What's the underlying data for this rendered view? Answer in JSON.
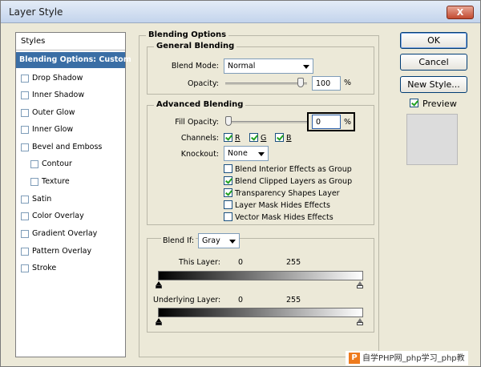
{
  "window": {
    "title": "Layer Style",
    "close_label": "X"
  },
  "styles": {
    "header": "Styles",
    "items": [
      {
        "label": "Blending Options: Custom",
        "active": true,
        "checkbox": false,
        "sub": false
      },
      {
        "label": "Drop Shadow",
        "active": false,
        "checkbox": true,
        "sub": false
      },
      {
        "label": "Inner Shadow",
        "active": false,
        "checkbox": true,
        "sub": false
      },
      {
        "label": "Outer Glow",
        "active": false,
        "checkbox": true,
        "sub": false
      },
      {
        "label": "Inner Glow",
        "active": false,
        "checkbox": true,
        "sub": false
      },
      {
        "label": "Bevel and Emboss",
        "active": false,
        "checkbox": true,
        "sub": false
      },
      {
        "label": "Contour",
        "active": false,
        "checkbox": true,
        "sub": true
      },
      {
        "label": "Texture",
        "active": false,
        "checkbox": true,
        "sub": true
      },
      {
        "label": "Satin",
        "active": false,
        "checkbox": true,
        "sub": false
      },
      {
        "label": "Color Overlay",
        "active": false,
        "checkbox": true,
        "sub": false
      },
      {
        "label": "Gradient Overlay",
        "active": false,
        "checkbox": true,
        "sub": false
      },
      {
        "label": "Pattern Overlay",
        "active": false,
        "checkbox": true,
        "sub": false
      },
      {
        "label": "Stroke",
        "active": false,
        "checkbox": true,
        "sub": false
      }
    ]
  },
  "blending_options": {
    "title": "Blending Options",
    "general": {
      "title": "General Blending",
      "blend_mode_label": "Blend Mode:",
      "blend_mode_value": "Normal",
      "opacity_label": "Opacity:",
      "opacity_value": "100",
      "opacity_unit": "%",
      "opacity_level": 1.0
    },
    "advanced": {
      "title": "Advanced Blending",
      "fill_opacity_label": "Fill Opacity:",
      "fill_opacity_value": "0",
      "fill_opacity_unit": "%",
      "fill_opacity_level": 0.0,
      "channels_label": "Channels:",
      "channels": [
        {
          "label": "R",
          "checked": true
        },
        {
          "label": "G",
          "checked": true
        },
        {
          "label": "B",
          "checked": true
        }
      ],
      "knockout_label": "Knockout:",
      "knockout_value": "None",
      "options": [
        {
          "label": "Blend Interior Effects as Group",
          "checked": false
        },
        {
          "label": "Blend Clipped Layers as Group",
          "checked": true
        },
        {
          "label": "Transparency Shapes Layer",
          "checked": true
        },
        {
          "label": "Layer Mask Hides Effects",
          "checked": false
        },
        {
          "label": "Vector Mask Hides Effects",
          "checked": false
        }
      ]
    },
    "blend_if": {
      "label": "Blend If:",
      "value": "Gray",
      "this_layer_label": "This Layer:",
      "this_layer_min": "0",
      "this_layer_max": "255",
      "underlying_label": "Underlying Layer:",
      "underlying_min": "0",
      "underlying_max": "255"
    }
  },
  "buttons": {
    "ok": "OK",
    "cancel": "Cancel",
    "new_style": "New Style...",
    "preview_label": "Preview",
    "preview_checked": true
  },
  "watermark": {
    "logo": "P",
    "text": "自学PHP网_php学习_php教"
  }
}
